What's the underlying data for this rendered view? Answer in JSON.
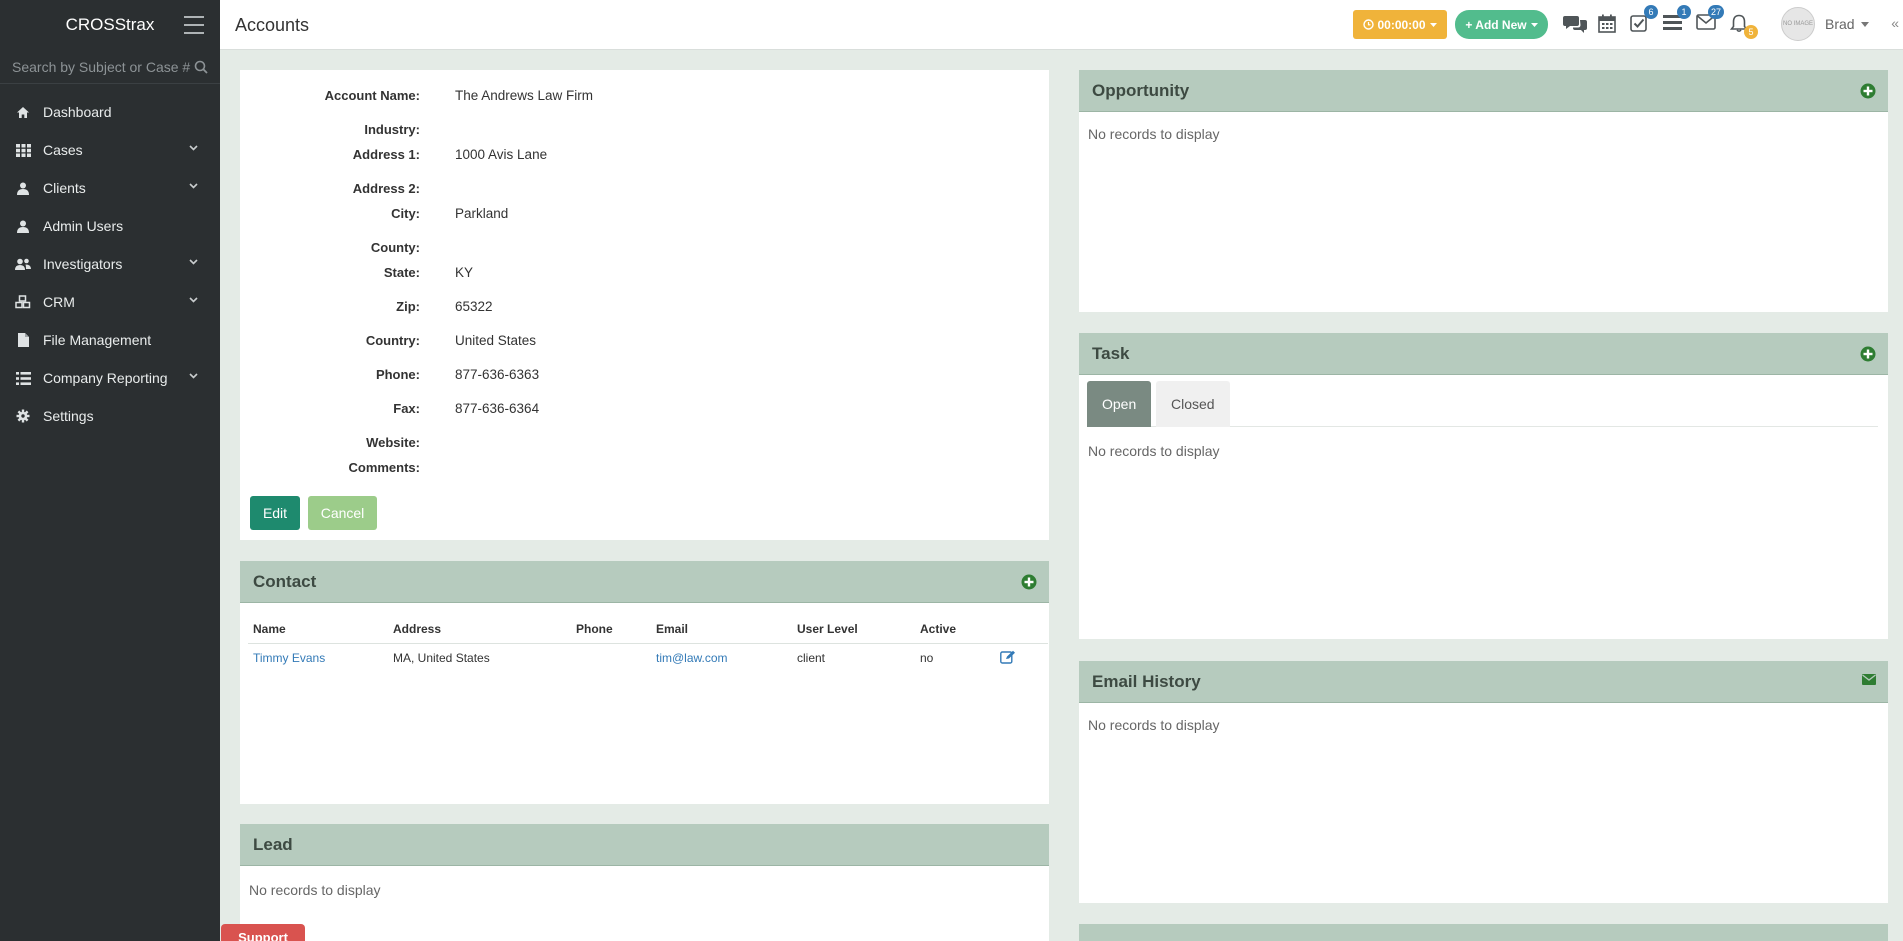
{
  "app": {
    "brand": "CROSStrax"
  },
  "search": {
    "placeholder": "Search by Subject or Case #"
  },
  "sidebar": {
    "items": [
      {
        "label": "Dashboard",
        "icon": "home-icon",
        "has_submenu": false
      },
      {
        "label": "Cases",
        "icon": "grid-icon",
        "has_submenu": true
      },
      {
        "label": "Clients",
        "icon": "user-icon",
        "has_submenu": true
      },
      {
        "label": "Admin Users",
        "icon": "user-icon",
        "has_submenu": false
      },
      {
        "label": "Investigators",
        "icon": "users-icon",
        "has_submenu": true
      },
      {
        "label": "CRM",
        "icon": "cubes-icon",
        "has_submenu": true
      },
      {
        "label": "File Management",
        "icon": "file-icon",
        "has_submenu": false
      },
      {
        "label": "Company Reporting",
        "icon": "list-icon",
        "has_submenu": true
      },
      {
        "label": "Settings",
        "icon": "gear-icon",
        "has_submenu": false
      }
    ]
  },
  "header": {
    "title": "Accounts",
    "timer_label": "00:00:00",
    "add_new_label": "+ Add New",
    "badges": {
      "tasks": "6",
      "list": "1",
      "mail": "27",
      "bell": "5"
    },
    "user_name": "Brad",
    "avatar_text": "NO IMAGE",
    "collapse": "«"
  },
  "account": {
    "fields": [
      {
        "label": "Account Name:",
        "value": "The Andrews Law Firm"
      },
      {
        "label": "Industry:",
        "value": ""
      },
      {
        "label": "Address 1:",
        "value": "1000 Avis Lane"
      },
      {
        "label": "Address 2:",
        "value": ""
      },
      {
        "label": "City:",
        "value": "Parkland"
      },
      {
        "label": "County:",
        "value": ""
      },
      {
        "label": "State:",
        "value": "KY"
      },
      {
        "label": "Zip:",
        "value": "65322"
      },
      {
        "label": "Country:",
        "value": "United States"
      },
      {
        "label": "Phone:",
        "value": "877-636-6363"
      },
      {
        "label": "Fax:",
        "value": "877-636-6364"
      },
      {
        "label": "Website:",
        "value": ""
      },
      {
        "label": "Comments:",
        "value": ""
      }
    ],
    "edit_label": "Edit",
    "cancel_label": "Cancel"
  },
  "contact": {
    "title": "Contact",
    "columns": [
      "Name",
      "Address",
      "Phone",
      "Email",
      "User Level",
      "Active"
    ],
    "rows": [
      {
        "name": "Timmy Evans",
        "address": "MA, United States",
        "phone": "",
        "email": "tim@law.com",
        "user_level": "client",
        "active": "no"
      }
    ]
  },
  "lead": {
    "title": "Lead",
    "empty": "No records to display"
  },
  "opportunity": {
    "title": "Opportunity",
    "empty": "No records to display"
  },
  "task": {
    "title": "Task",
    "tabs": [
      "Open",
      "Closed"
    ],
    "active_tab": "Open",
    "empty": "No records to display"
  },
  "email_history": {
    "title": "Email History",
    "empty": "No records to display"
  },
  "support": {
    "label": "Support"
  },
  "colors": {
    "sidebar": "#2b2f31",
    "panel_header": "#b6cbbe",
    "accent_green": "#1e8a6e",
    "timer": "#f0b33a",
    "add_new": "#52bc8d",
    "link": "#337ab7"
  }
}
